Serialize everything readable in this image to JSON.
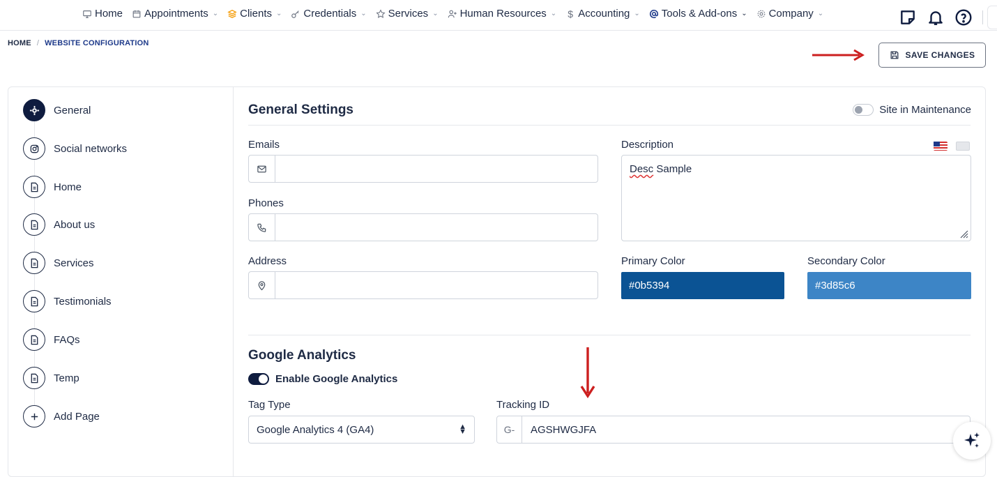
{
  "nav": {
    "items": [
      {
        "label": "Home",
        "icon": "monitor-icon",
        "chevron": false
      },
      {
        "label": "Appointments",
        "icon": "calendar-icon",
        "chevron": true
      },
      {
        "label": "Clients",
        "icon": "layers-icon",
        "chevron": true
      },
      {
        "label": "Credentials",
        "icon": "key-icon",
        "chevron": true
      },
      {
        "label": "Services",
        "icon": "star-icon",
        "chevron": true
      },
      {
        "label": "Human Resources",
        "icon": "user-add-icon",
        "chevron": true
      },
      {
        "label": "Accounting",
        "icon": "dollar-icon",
        "chevron": true
      },
      {
        "label": "Tools & Add-ons",
        "icon": "at-icon",
        "chevron": true
      },
      {
        "label": "Company",
        "icon": "gear-icon",
        "chevron": true
      }
    ],
    "right_icons": [
      "note-icon",
      "bell-icon",
      "help-icon"
    ]
  },
  "breadcrumb": {
    "home": "HOME",
    "separator": "/",
    "current": "WEBSITE CONFIGURATION"
  },
  "toolbar": {
    "save_label": "SAVE CHANGES"
  },
  "sidebar": {
    "items": [
      {
        "label": "General",
        "icon": "gear-icon",
        "active": true
      },
      {
        "label": "Social networks",
        "icon": "instagram-icon",
        "active": false
      },
      {
        "label": "Home",
        "icon": "document-icon",
        "active": false
      },
      {
        "label": "About us",
        "icon": "document-icon",
        "active": false
      },
      {
        "label": "Services",
        "icon": "document-icon",
        "active": false
      },
      {
        "label": "Testimonials",
        "icon": "document-icon",
        "active": false
      },
      {
        "label": "FAQs",
        "icon": "document-icon",
        "active": false
      },
      {
        "label": "Temp",
        "icon": "document-icon",
        "active": false
      },
      {
        "label": "Add Page",
        "icon": "plus-icon",
        "active": false
      }
    ]
  },
  "general": {
    "title": "General Settings",
    "maintenance_label": "Site in Maintenance",
    "maintenance_on": false,
    "emails_label": "Emails",
    "emails_value": "",
    "phones_label": "Phones",
    "phones_value": "",
    "address_label": "Address",
    "address_value": "",
    "description_label": "Description",
    "description_value_word1": "Desc",
    "description_value_rest": " Sample",
    "primary_color_label": "Primary Color",
    "primary_color_value": "#0b5394",
    "secondary_color_label": "Secondary Color",
    "secondary_color_value": "#3d85c6"
  },
  "analytics": {
    "title": "Google Analytics",
    "enable_label": "Enable Google Analytics",
    "enabled": true,
    "tag_type_label": "Tag Type",
    "tag_type_value": "Google Analytics 4 (GA4)",
    "tracking_label": "Tracking ID",
    "tracking_prefix": "G-",
    "tracking_value": "AGSHWGJFA"
  },
  "colors": {
    "navy": "#0f1c3f",
    "annotation_red": "#cc1f1f",
    "border": "#cfd4dc"
  }
}
